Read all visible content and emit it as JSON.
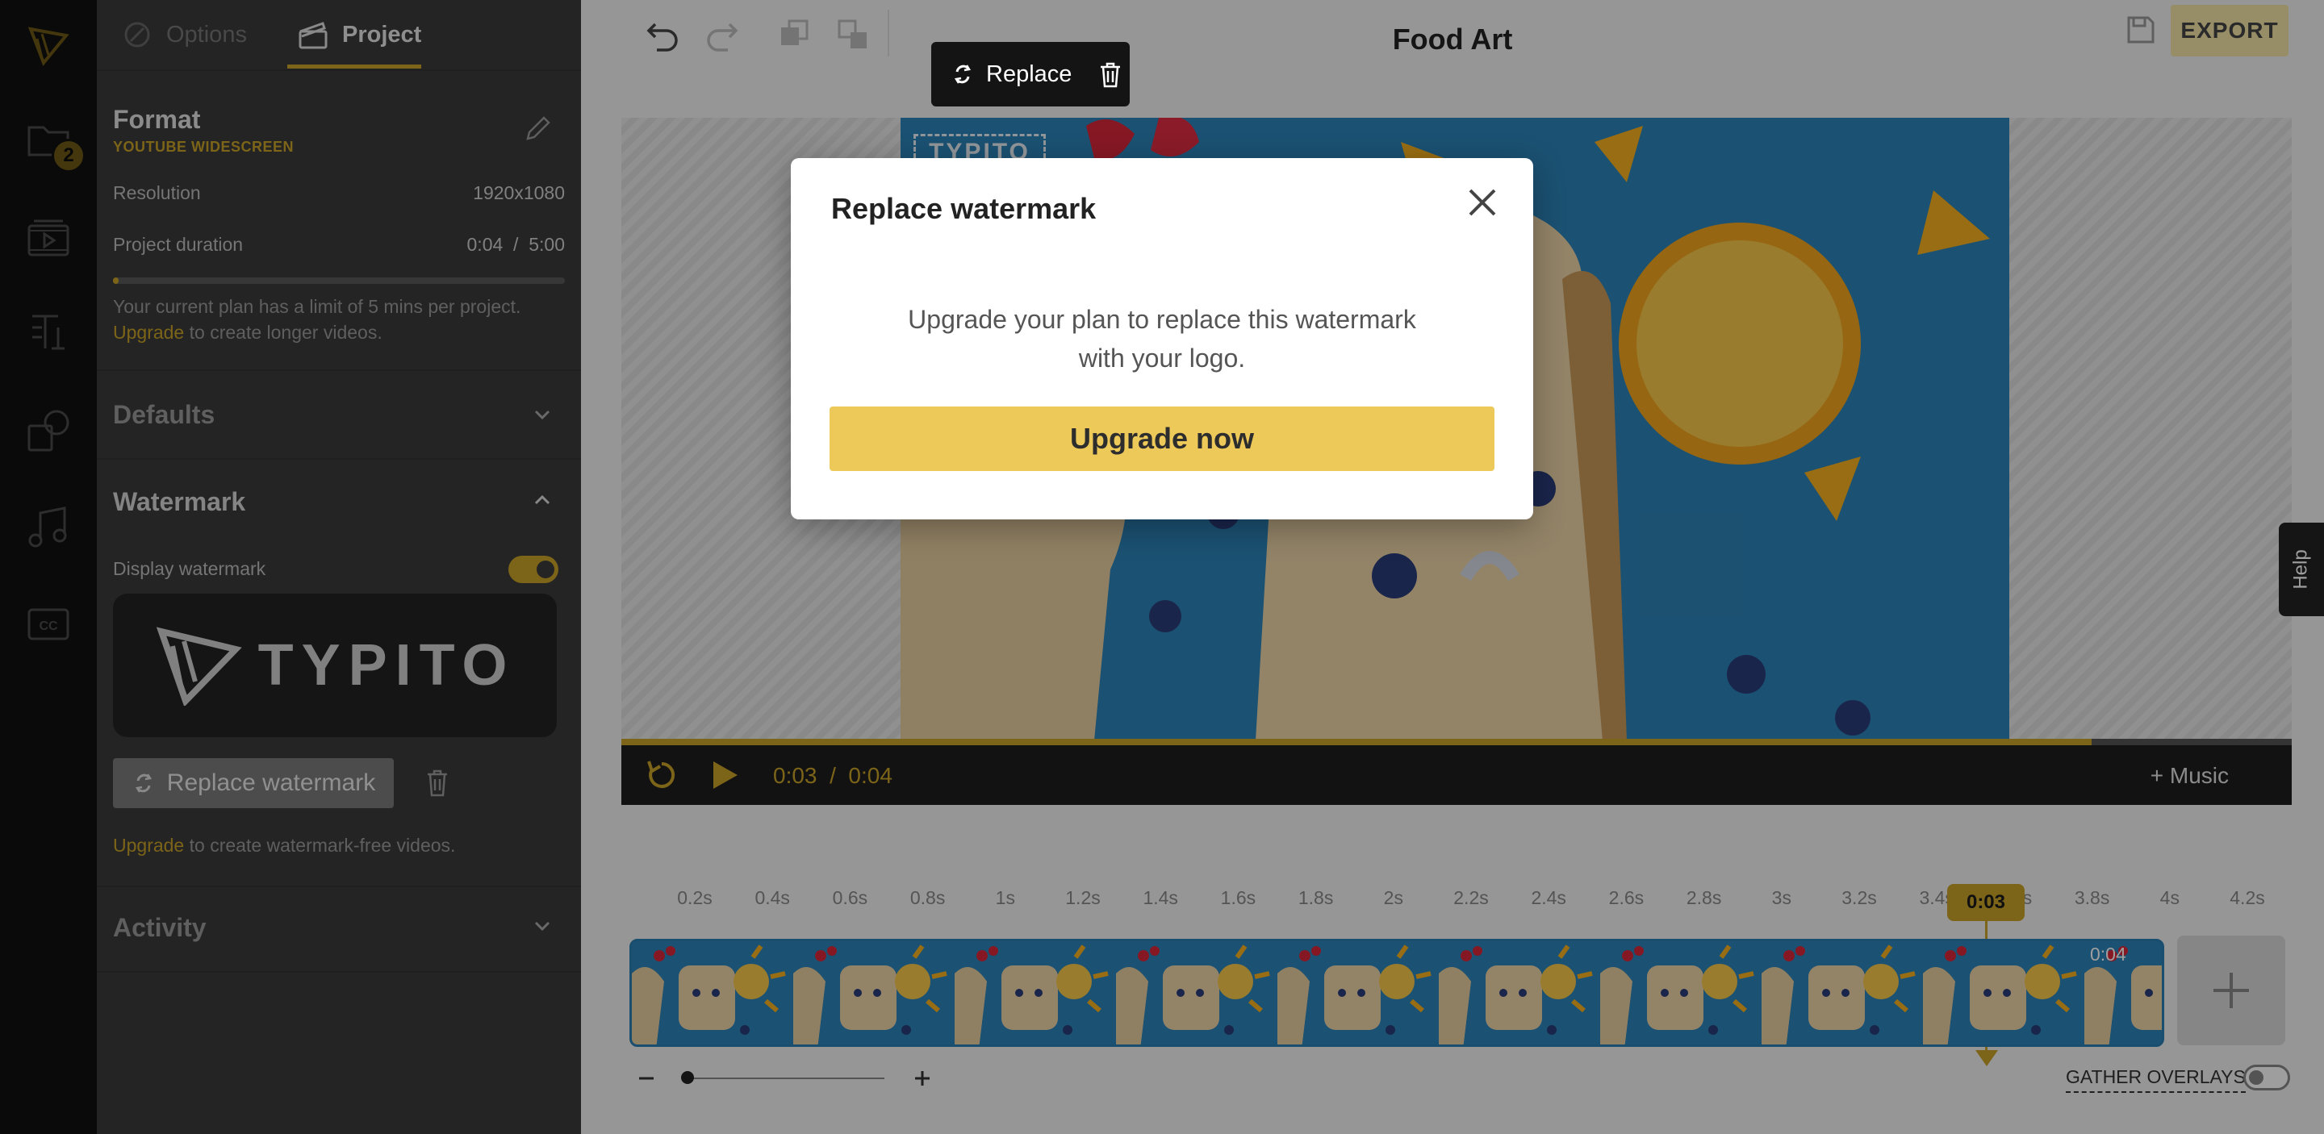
{
  "rail": {
    "items": [
      {
        "name": "logo-icon"
      },
      {
        "name": "folder-icon",
        "badge": "2"
      },
      {
        "name": "media-icon"
      },
      {
        "name": "text-icon"
      },
      {
        "name": "shapes-icon"
      },
      {
        "name": "music-icon"
      },
      {
        "name": "captions-icon"
      }
    ]
  },
  "panel": {
    "tabs": {
      "options": "Options",
      "project": "Project"
    },
    "format": {
      "title": "Format",
      "subtitle": "YOUTUBE WIDESCREEN"
    },
    "resolution": {
      "label": "Resolution",
      "value": "1920x1080"
    },
    "duration": {
      "label": "Project duration",
      "value": "0:04  /  5:00",
      "progress": 0.013
    },
    "plan_note": {
      "line1": "Your current plan has a limit of 5 mins per project.",
      "link": "Upgrade",
      "line2": " to create longer videos."
    },
    "sections": {
      "defaults": "Defaults",
      "watermark": "Watermark",
      "activity": "Activity"
    },
    "watermark": {
      "display_label": "Display watermark",
      "display_on": true,
      "preview_text": "TYPITO",
      "replace_button": "Replace watermark",
      "note_link": "Upgrade",
      "note_text": " to create watermark-free videos."
    }
  },
  "topbar": {
    "title": "Food Art",
    "export": "EXPORT",
    "floating_replace": "Replace"
  },
  "stage": {
    "watermark_text": "TYPITO",
    "time_current": "0:03",
    "time_total": "0:04",
    "time_sep": "/",
    "music": "+ Music",
    "progress": 0.88
  },
  "timeline": {
    "ticks": [
      "0.2s",
      "0.4s",
      "0.6s",
      "0.8s",
      "1s",
      "1.2s",
      "1.4s",
      "1.6s",
      "1.8s",
      "2s",
      "2.2s",
      "2.4s",
      "2.6s",
      "2.8s",
      "3s",
      "3.2s",
      "3.4s",
      "3.6s",
      "3.8s",
      "4s",
      "4.2s"
    ],
    "playhead": "0:03",
    "clip_duration": "0:04",
    "thumb_count": 10,
    "gather_label": "GATHER OVERLAYS",
    "gather_on": false
  },
  "help": "Help",
  "modal": {
    "title": "Replace watermark",
    "text_line1": "Upgrade your plan to replace this watermark",
    "text_line2": "with your logo.",
    "button": "Upgrade now"
  },
  "colors": {
    "accent": "#c9a227",
    "upgrade_button": "#edc95a",
    "panel_bg": "#3a3a3a",
    "rail_bg": "#1f1f1f"
  }
}
